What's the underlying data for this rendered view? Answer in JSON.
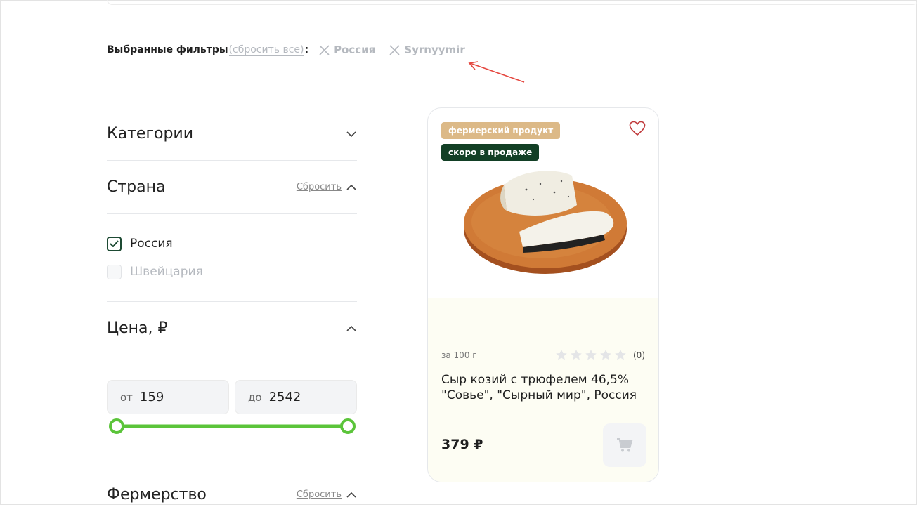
{
  "filters": {
    "title": "Выбранные фильтры",
    "reset_all": "(сбросить все)",
    "colon": ":",
    "chips": [
      {
        "label": "Россия"
      },
      {
        "label": "Syrnyymir"
      }
    ]
  },
  "sidebar": {
    "categories": {
      "title": "Категории"
    },
    "country": {
      "title": "Страна",
      "reset": "Сбросить",
      "options": [
        {
          "label": "Россия",
          "checked": true
        },
        {
          "label": "Швейцария",
          "checked": false
        }
      ]
    },
    "price": {
      "title": "Цена, ₽",
      "from_label": "от",
      "from_value": "159",
      "to_label": "до",
      "to_value": "2542"
    },
    "farm": {
      "title": "Фермерство",
      "reset": "Сбросить"
    }
  },
  "product": {
    "badge_farm": "фермерский продукт",
    "badge_soon": "скоро в продаже",
    "weight": "за 100 г",
    "rating_count": "(0)",
    "rating_value": 0,
    "rating_max": 5,
    "name_line1": "Сыр козий с трюфелем 46,5%",
    "name_line2": "\"Совье\", \"Сырный мир\", Россия",
    "price": "379 ₽"
  },
  "colors": {
    "accent_green": "#5bc43a",
    "dark_green": "#123f25",
    "farm_badge": "#dcb987",
    "annotation_red": "#e5473f"
  }
}
